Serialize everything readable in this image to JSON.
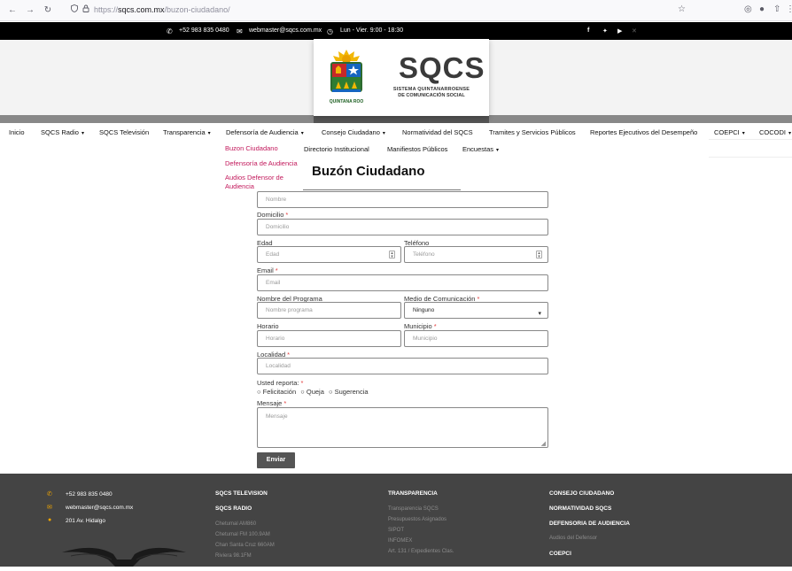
{
  "browser": {
    "url_prefix": "https://",
    "url_domain": "sqcs.com.mx",
    "url_path": "/buzon-ciudadano/"
  },
  "topbar": {
    "phone": "+52 983 835 0480",
    "email": "webmaster@sqcs.com.mx",
    "hours": "Lun - Vier. 9:00 - 18:30"
  },
  "logo": {
    "shield_caption": "QUINTANA ROO",
    "title": "SQCS",
    "subtitle_1": "SISTEMA QUINTANARROENSE",
    "subtitle_2": "DE COMUNICACIÓN SOCIAL"
  },
  "nav": {
    "items": [
      "Inicio",
      "SQCS Radio",
      "SQCS Televisión",
      "Transparencia",
      "Defensoría de Audiencia",
      "Consejo Ciudadano",
      "Normatividad del SQCS",
      "Tramites y Servicios Públicos",
      "Reportes Ejecutivos del Desempeño",
      "COEPCI",
      "COCODI"
    ],
    "sub_items": [
      "Directorio Institucional",
      "Manifiestos Públicos",
      "Encuestas"
    ],
    "dropdown": [
      "Buzon Ciudadano",
      "Defensoría de Audiencia",
      "Audios Defensor de",
      "Audiencia"
    ]
  },
  "form": {
    "title": "Buzón Ciudadano",
    "nombre_placeholder": "Nombre",
    "domicilio_label": "Domicilio",
    "domicilio_placeholder": "Domicilio",
    "edad_label": "Edad",
    "edad_placeholder": "Edad",
    "telefono_label": "Teléfono",
    "telefono_placeholder": "Teléfono",
    "email_label": "Email",
    "email_placeholder": "Email",
    "programa_label": "Nombre del Programa",
    "programa_placeholder": "Nombre programa",
    "medio_label": "Medio de Comunicación",
    "medio_value": "Ninguno",
    "horario_label": "Horario",
    "horario_placeholder": "Horario",
    "municipio_label": "Municipio",
    "municipio_placeholder": "Municipio",
    "localidad_label": "Localidad",
    "localidad_placeholder": "Localidad",
    "reporta_label": "Usted reporta:",
    "radio_options": [
      "Felicitación",
      "Queja",
      "Sugerencia"
    ],
    "mensaje_label": "Mensaje",
    "mensaje_placeholder": "Mensaje",
    "submit": "Enviar"
  },
  "footer": {
    "phone": "+52 983 835 0480",
    "email": "webmaster@sqcs.com.mx",
    "address": "201 Av. Hidalgo",
    "col2": {
      "h1": "SQCS TELEVISION",
      "h2": "SQCS RADIO",
      "links": [
        "Chetumal AM860",
        "Chetumal FM 100.9AM",
        "Chan Santa Cruz 660AM",
        "Riviera 98.1FM"
      ]
    },
    "col3": {
      "h1": "TRANSPARENCIA",
      "links": [
        "Transparencia SQCS",
        "Presupuestos Asignados",
        "SIPOT",
        "INFOMEX",
        "Art. 131 / Expedientes Clas."
      ]
    },
    "col4": {
      "h1": "CONSEJO CIUDADANO",
      "h2": "NORMATIVIDAD SQCS",
      "h3": "DEFENSORIA DE AUDIENCIA",
      "links": [
        "Audios del Defensor"
      ],
      "h4": "COEPCI"
    }
  },
  "colors": {
    "accent_pink": "#c2185b",
    "footer_bg": "#444444",
    "footer_icon": "#f0a500",
    "topbar_bg": "#000000"
  }
}
